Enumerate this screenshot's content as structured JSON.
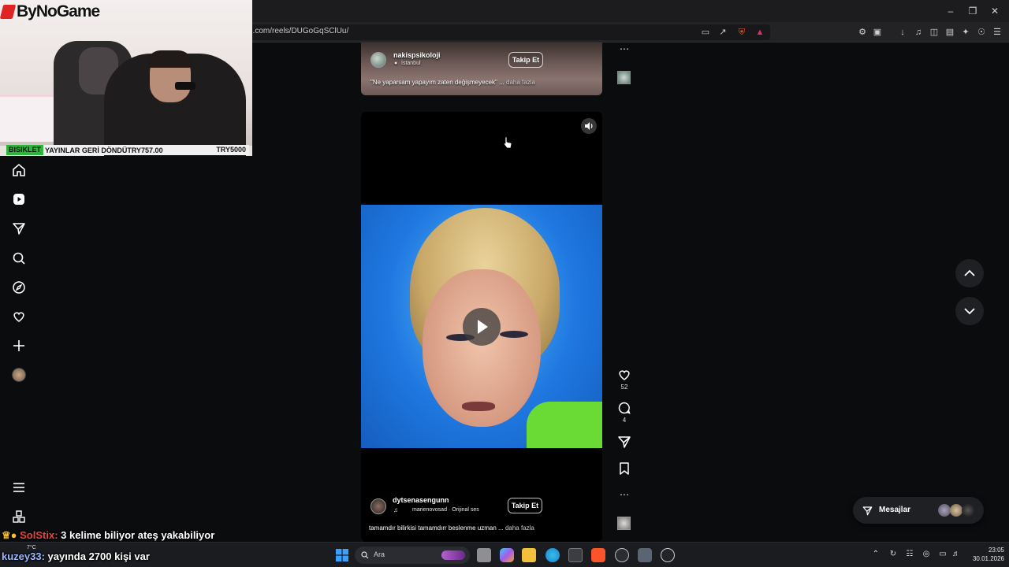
{
  "browser": {
    "url": "n.com/reels/DUGoGqSClUu/"
  },
  "webcam": {
    "logo": "ByNoGame",
    "ticker_tag": "BISIKLET",
    "ticker_text": "YAYINLAR GERİ DÖNDÜ",
    "ticker_amount": "TRY757.00",
    "ticker_amount2": "TRY5000"
  },
  "feed": {
    "post1": {
      "username": "nakispsikoloji",
      "location": "İstanbul",
      "follow_label": "Takip Et",
      "caption": "\"Ne yaparsam yapayım zaten değişmeyecek\" ...",
      "more": "daha fazla"
    },
    "post2": {
      "username": "dytsenasengunn",
      "audio": "marienovosad · Orijinal ses",
      "follow_label": "Takip Et",
      "caption": "tamamdır bilirkisi tamamdırr beslenme uzman ...",
      "more": "daha fazla",
      "likes": "52",
      "comments": "4"
    }
  },
  "messages": {
    "label": "Mesajlar"
  },
  "chat_overlay": [
    {
      "user": "SolStix:",
      "text": "3 kelime biliyor ateş yakabiliyor"
    },
    {
      "user": "kuzey33:",
      "text": "yayında 2700 kişi var"
    }
  ],
  "taskbar": {
    "search_placeholder": "Ara",
    "weather": "7°C",
    "time": "23:05",
    "date": "30.01.2026"
  },
  "colors": {
    "background": "#0b0c0e",
    "accent_red": "#e02424",
    "chat_user": "#e6473e",
    "ticker_green": "#2db53d"
  }
}
